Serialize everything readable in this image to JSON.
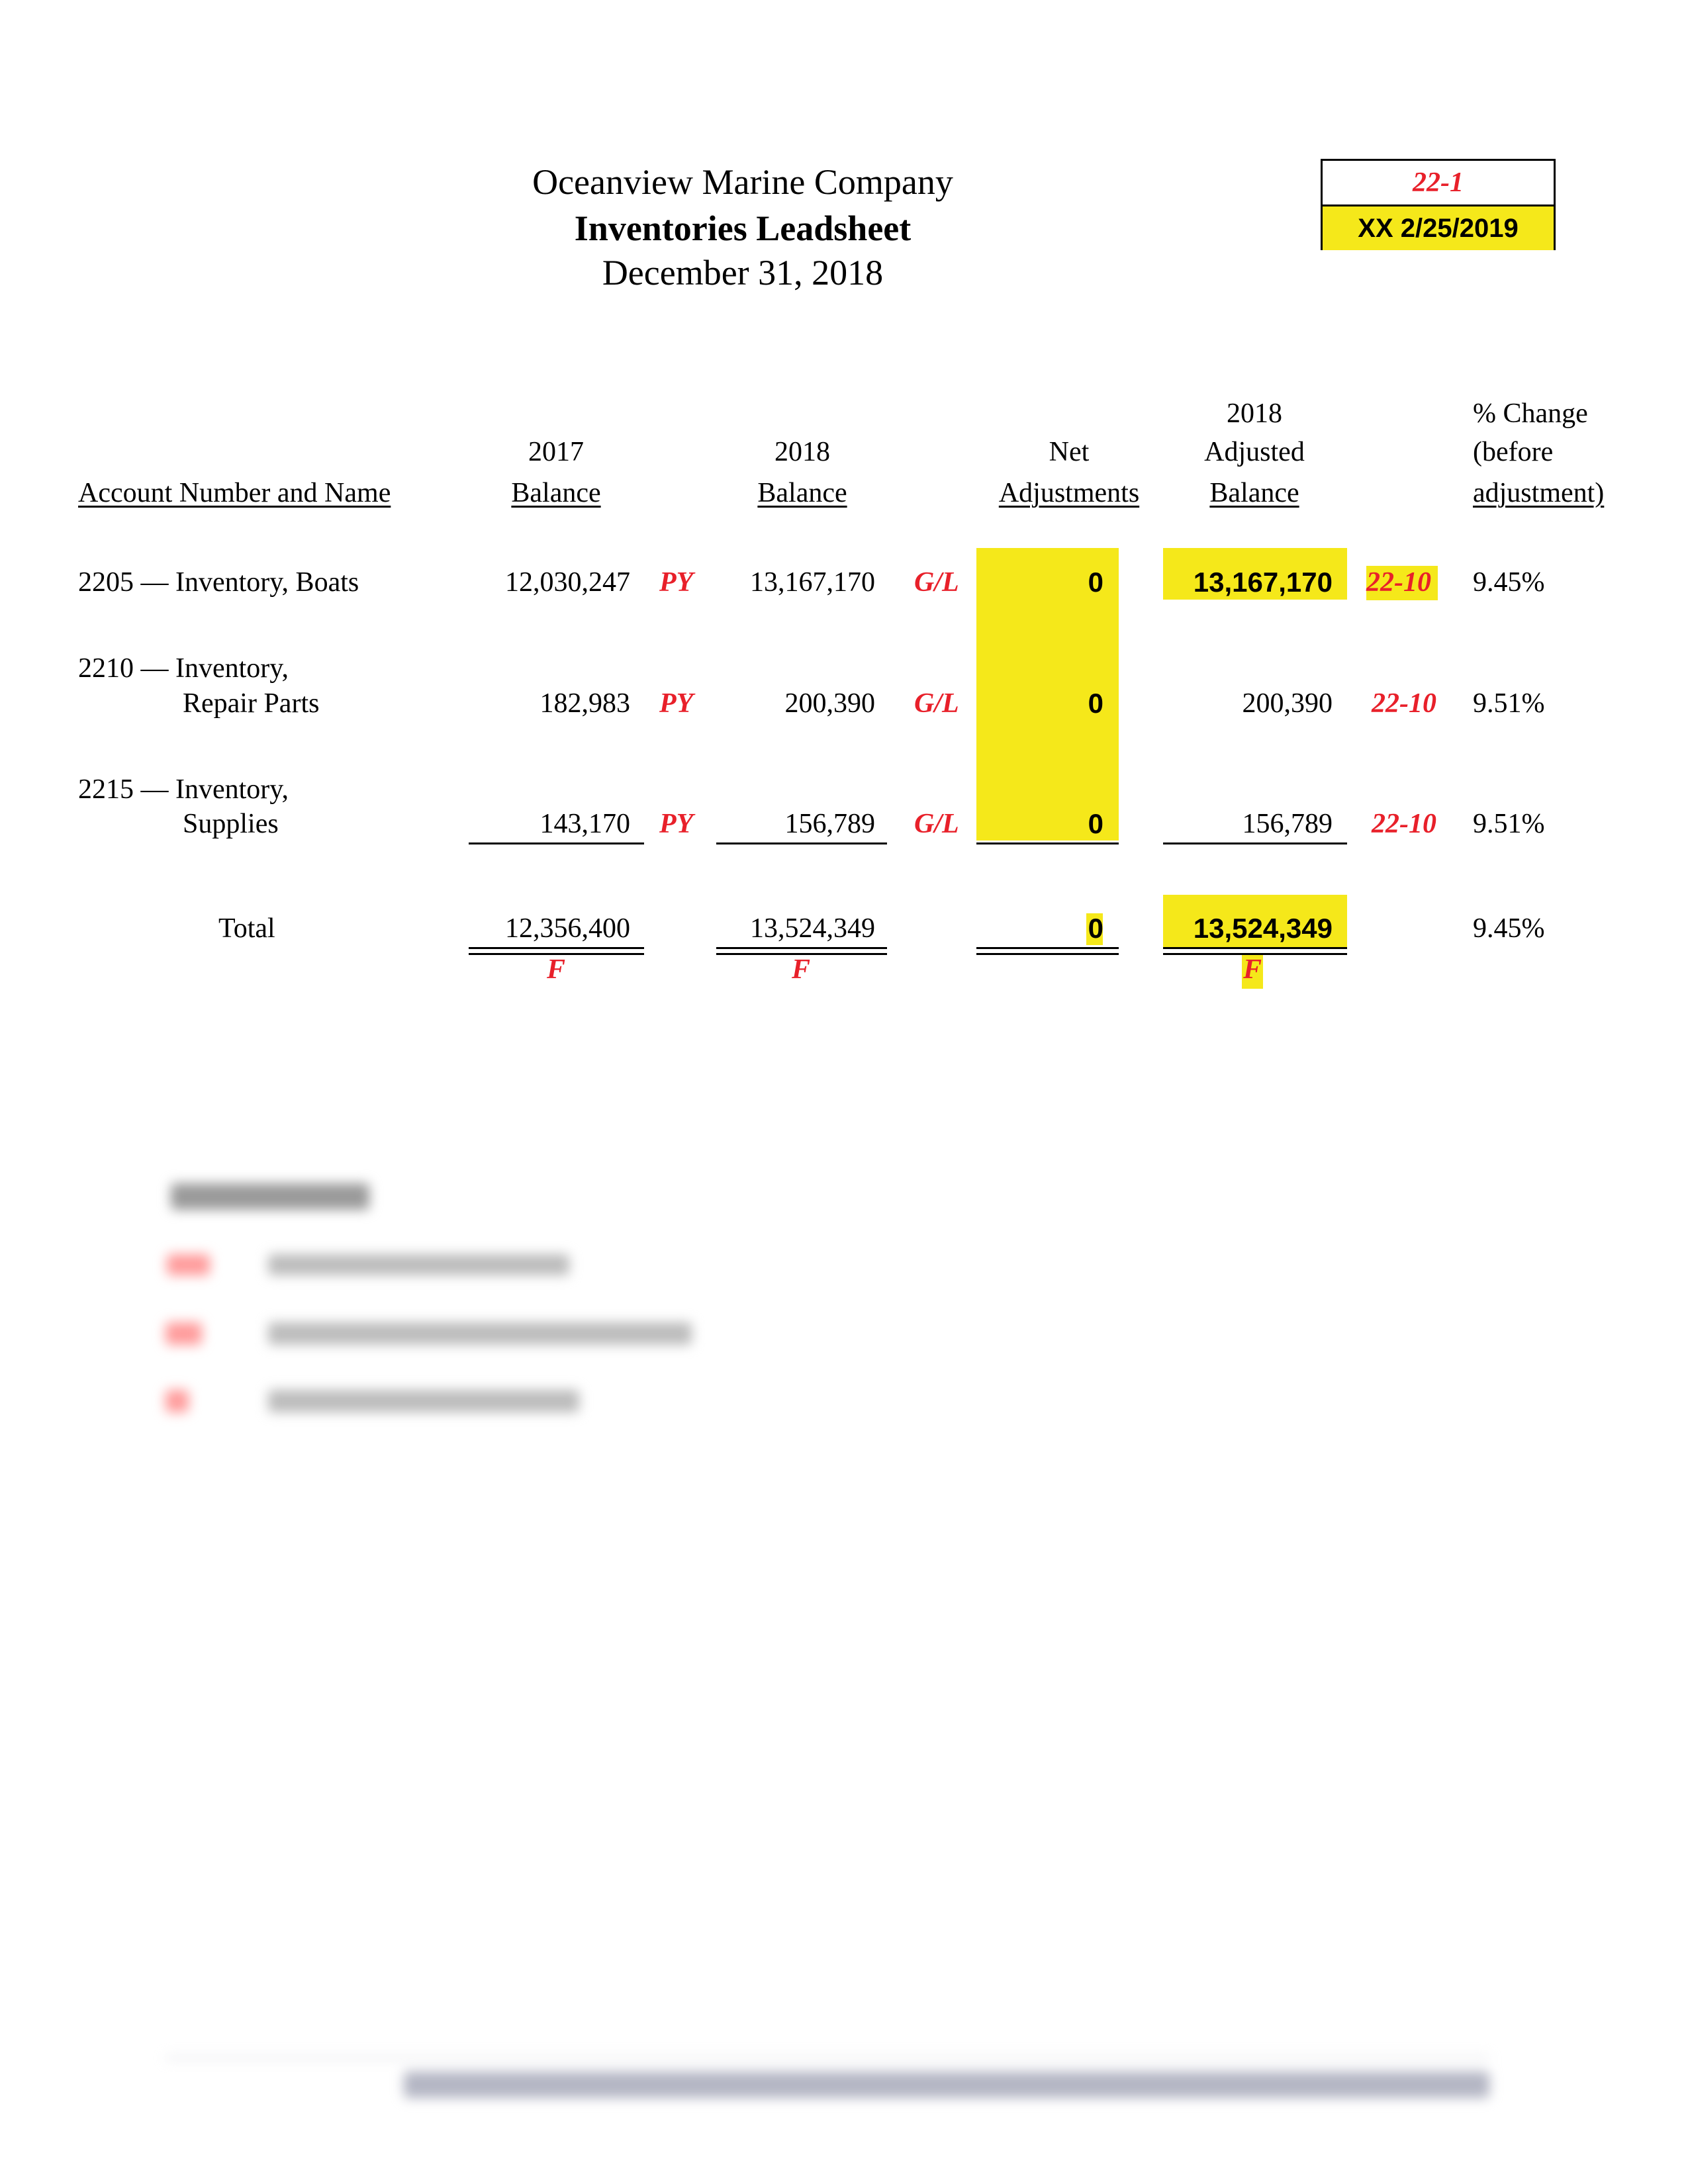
{
  "header": {
    "company": "Oceanview Marine Company",
    "title": "Inventories Leadsheet",
    "date": "December 31, 2018"
  },
  "reference_box": {
    "workpaper_ref": "22-1",
    "preparer_signoff": "XX  2/25/2019"
  },
  "columns": {
    "account": "Account Number and Name",
    "bal_2017_line1": "2017",
    "bal_2017_line2": "Balance",
    "bal_2018_line1": "2018",
    "bal_2018_line2": "Balance",
    "net_adj_line1": "Net",
    "net_adj_line2": "Adjustments",
    "adj_bal_line1": "2018",
    "adj_bal_line2": "Adjusted",
    "adj_bal_line3": "Balance",
    "pct_line1": "% Change",
    "pct_line2": "(before",
    "pct_line3": "adjustment)"
  },
  "rows": [
    {
      "account_line1": "2205 — Inventory, Boats",
      "account_line2": "",
      "bal_2017": "12,030,247",
      "tick_2017": "PY",
      "bal_2018": "13,167,170",
      "tick_2018": "G/L",
      "net_adj": "0",
      "adj_bal": "13,167,170",
      "ref": "22-10",
      "pct_change": "9.45%"
    },
    {
      "account_line1": "2210 — Inventory,",
      "account_line2": "Repair Parts",
      "bal_2017": "182,983",
      "tick_2017": "PY",
      "bal_2018": "200,390",
      "tick_2018": "G/L",
      "net_adj": "0",
      "adj_bal": "200,390",
      "ref": "22-10",
      "pct_change": "9.51%"
    },
    {
      "account_line1": "2215 — Inventory,",
      "account_line2": "Supplies",
      "bal_2017": "143,170",
      "tick_2017": "PY",
      "bal_2018": "156,789",
      "tick_2018": "G/L",
      "net_adj": "0",
      "adj_bal": "156,789",
      "ref": "22-10",
      "pct_change": "9.51%"
    }
  ],
  "total": {
    "label": "Total",
    "bal_2017": "12,356,400",
    "bal_2018": "13,524,349",
    "net_adj": "0",
    "adj_bal": "13,524,349",
    "pct_change": "9.45%",
    "foot_tick": "F"
  },
  "colors": {
    "tickmark_red": "#e8202a",
    "highlight_yellow": "#f5e81a"
  }
}
